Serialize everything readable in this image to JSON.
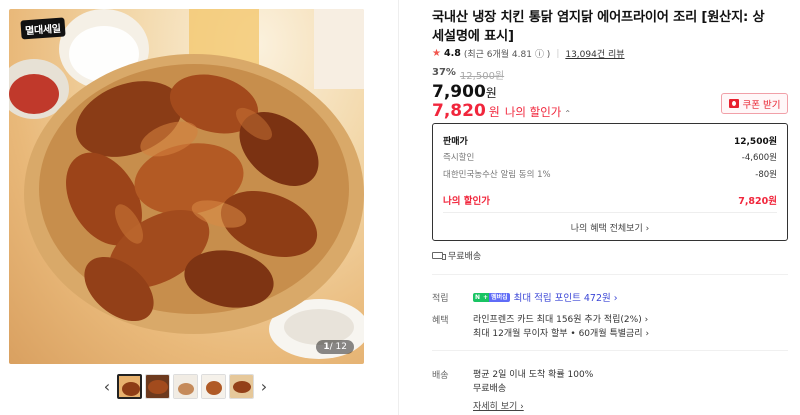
{
  "gallery": {
    "badge": "멸대세일",
    "counter_current": "1",
    "counter_total": "/ 12",
    "prev": "‹",
    "next": "›"
  },
  "product": {
    "title": "국내산 냉장 치킨 통닭 염지닭 에어프라이어 조리 [원산지: 상세설명에 표시]",
    "rating": "4.8",
    "rating_recent": "(최근 6개월 4.81",
    "rating_info": "ⓘ )",
    "review_count": "13,094건 리뷰",
    "discount_pct": "37%",
    "original_price": "12,500원",
    "price": "7,900",
    "price_unit": "원",
    "my_price": "7,820",
    "my_price_unit": "원",
    "my_price_label": "나의 할인가",
    "my_price_caret": "⌃",
    "coupon_button": "쿠폰 받기"
  },
  "price_breakdown": {
    "rows": [
      {
        "label": "판매가",
        "value": "12,500원"
      },
      {
        "label": "즉시할인",
        "value": "-4,600원"
      },
      {
        "label": "대한민국농수산 알림 동의 1%",
        "value": "-80원"
      }
    ],
    "my_label": "나의 할인가",
    "my_value": "7,820원",
    "more": "나의 혜택 전체보기 ›"
  },
  "shipping_summary": "무료배송",
  "attributes": {
    "points_label": "적립",
    "points_badge_n": "N",
    "points_badge_plus": "+",
    "points_badge_m": "멤버십",
    "points_text": "최대 적립 포인트 472원 ›",
    "benefit_label": "혜택",
    "benefit_line1": "라인프렌즈 카드 최대 156원 추가 적립(2%) ›",
    "benefit_line2": "최대 12개월 무이자 할부 • 60개월 특별금리 ›",
    "delivery_label": "배송",
    "delivery_line1": "평균 2일 이내 도착 확률 100%",
    "delivery_line2": "무료배송",
    "delivery_more": "자세히 보기 ›"
  },
  "colors": {
    "accent_red": "#f1263c",
    "points_blue": "#3b46d6",
    "npay_green": "#19c463"
  }
}
